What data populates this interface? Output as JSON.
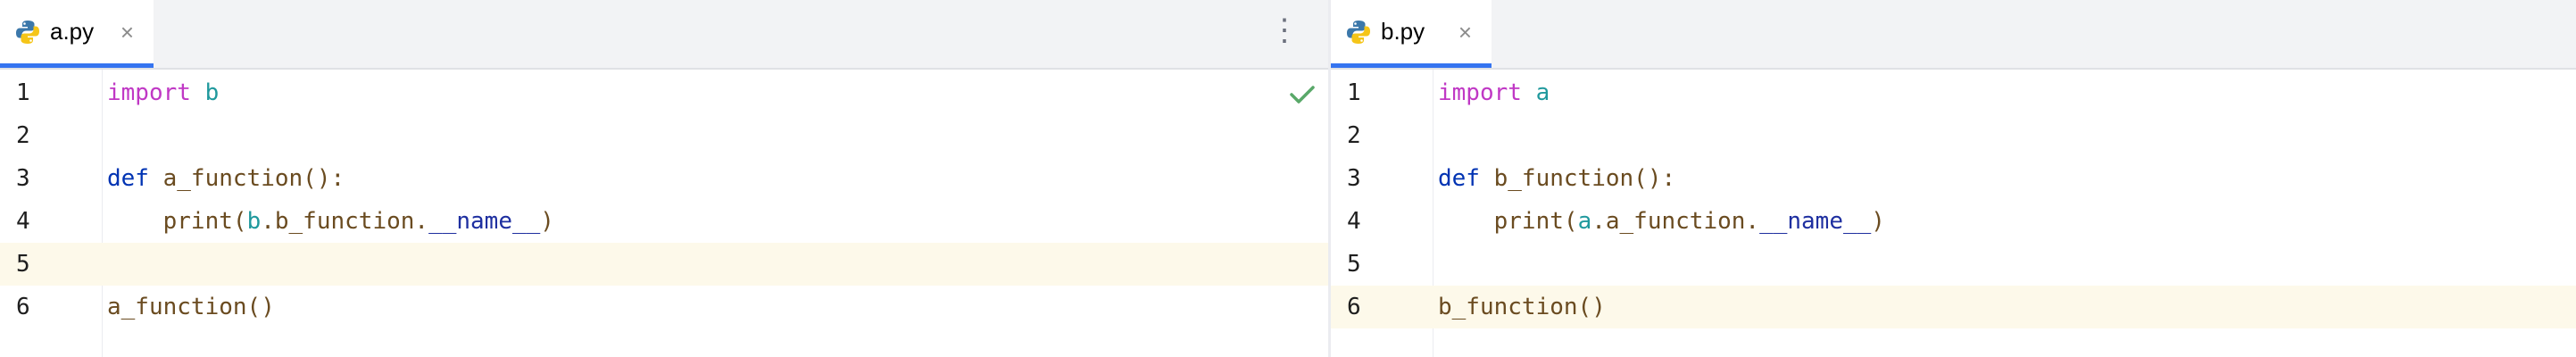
{
  "left_pane": {
    "tab": {
      "title": "a.py",
      "icon": "python-file-icon",
      "close": "×"
    },
    "menu_glyph": "⋮",
    "status_icon": "checkmark-icon",
    "lines": [
      {
        "num": "1",
        "t0": "import",
        "t1": " ",
        "t2": "b"
      },
      {
        "num": "2"
      },
      {
        "num": "3",
        "t0": "def",
        "t1": " ",
        "t2": "a_function",
        "t3": "():"
      },
      {
        "num": "4",
        "t0": "    ",
        "t1": "print",
        "t2": "(",
        "t3": "b",
        "t4": ".b_function.",
        "t5": "__name__",
        "t6": ")"
      },
      {
        "num": "5"
      },
      {
        "num": "6",
        "t0": "a_function",
        "t1": "()"
      }
    ]
  },
  "right_pane": {
    "tab": {
      "title": "b.py",
      "icon": "python-file-icon",
      "close": "×"
    },
    "lines": [
      {
        "num": "1",
        "t0": "import",
        "t1": " ",
        "t2": "a"
      },
      {
        "num": "2"
      },
      {
        "num": "3",
        "t0": "def",
        "t1": " ",
        "t2": "b_function",
        "t3": "():"
      },
      {
        "num": "4",
        "t0": "    ",
        "t1": "print",
        "t2": "(",
        "t3": "a",
        "t4": ".a_function.",
        "t5": "__name__",
        "t6": ")"
      },
      {
        "num": "5"
      },
      {
        "num": "6",
        "t0": "b_function",
        "t1": "()"
      }
    ]
  },
  "colors": {
    "keyword_def": "#0033b3",
    "keyword_import": "#c038c5",
    "module": "#20999d",
    "function": "#6a4b20",
    "dunder": "#1e2fa0",
    "caret_line": "#fdf9ea",
    "active_tab_underline": "#3574f0",
    "check": "#59a869"
  }
}
